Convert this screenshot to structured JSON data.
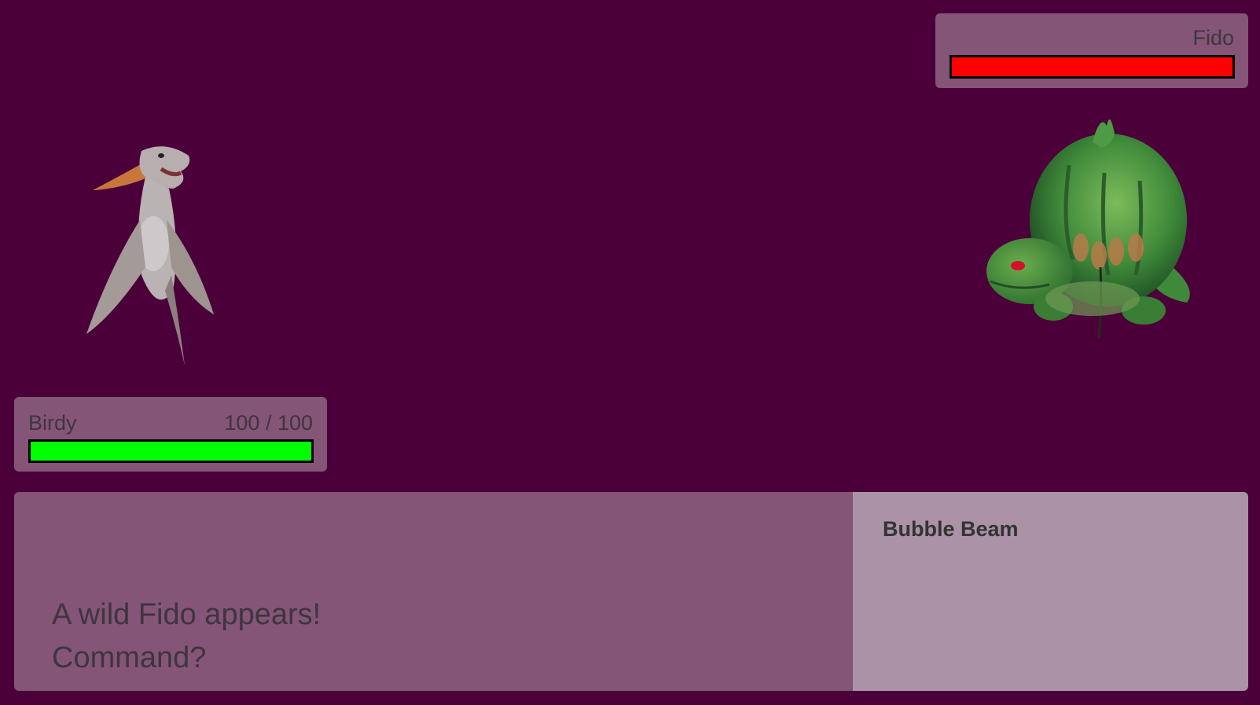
{
  "enemy": {
    "name": "Fido",
    "hp_fraction": 1.0,
    "hp_color": "#ff0000",
    "sprite_icon": "green-toad-creature-icon"
  },
  "player": {
    "name": "Birdy",
    "hp_text": "100 / 100",
    "hp_fraction": 1.0,
    "hp_color": "#00ff00",
    "sprite_icon": "pterosaur-creature-icon"
  },
  "message": {
    "line1": "A wild Fido appears!",
    "line2": "Command?"
  },
  "moves": [
    {
      "label": "Bubble Beam"
    }
  ],
  "colors": {
    "background": "#4c003a",
    "panel": "#845576",
    "command_panel": "#ab92a6"
  }
}
